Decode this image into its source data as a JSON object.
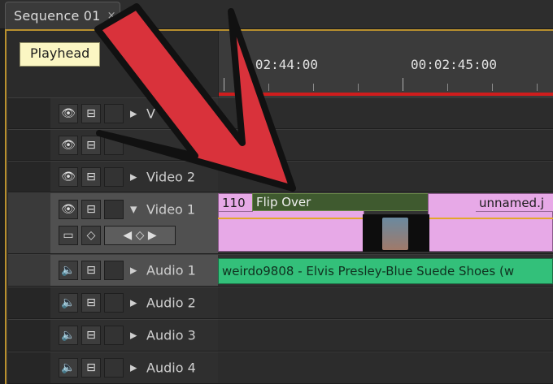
{
  "sequence": {
    "tab_label": "Sequence 01",
    "close_glyph": "×"
  },
  "tooltip": {
    "text": "Playhead"
  },
  "ruler": {
    "timecodes": [
      "00:02:44:00",
      "00:02:45:00"
    ]
  },
  "tracks": [
    {
      "name": "V",
      "type": "video",
      "eye": "👁",
      "lock": "⊟",
      "expanded": false
    },
    {
      "name": "",
      "type": "video",
      "eye": "👁",
      "lock": "⊟",
      "expanded": false
    },
    {
      "name": "Video 2",
      "type": "video",
      "eye": "👁",
      "lock": "⊟",
      "expanded": false
    },
    {
      "name": "Video 1",
      "type": "video",
      "eye": "👁",
      "lock": "⊟",
      "expanded": true
    },
    {
      "name": "Audio 1",
      "type": "audio",
      "eye": "🔈",
      "lock": "⊟",
      "expanded": false
    },
    {
      "name": "Audio 2",
      "type": "audio",
      "eye": "🔈",
      "lock": "⊟",
      "expanded": false
    },
    {
      "name": "Audio 3",
      "type": "audio",
      "eye": "🔈",
      "lock": "⊟",
      "expanded": false
    },
    {
      "name": "Audio 4",
      "type": "audio",
      "eye": "🔈",
      "lock": "⊟",
      "expanded": false
    }
  ],
  "clips": {
    "video1_left_label": "110",
    "transition_label": "Flip Over",
    "video1_right_label": "unnamed.j",
    "audio1_label": "weirdo9808 - Elvis Presley-Blue Suede Shoes (w"
  },
  "colors": {
    "annotation_arrow": "#d9323b",
    "panel_highlight": "#b9902e",
    "video_clip": "#e7a9e7",
    "audio_clip": "#33c07a"
  }
}
